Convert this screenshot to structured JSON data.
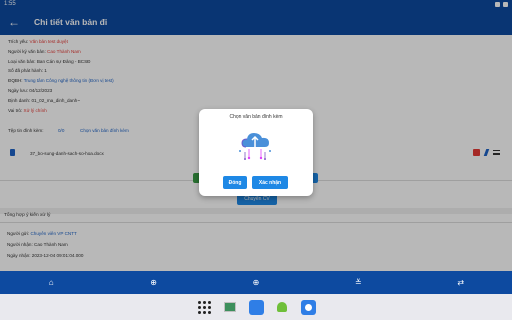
{
  "status_bar": {
    "time": "1:55"
  },
  "app_bar": {
    "title": "Chi tiết văn bản đi"
  },
  "info": {
    "trich_yeu_label": "Trích yếu:",
    "trich_yeu_value": "Văn bản test duyệt",
    "nguoi_ky_label": "Người ký văn bản:",
    "nguoi_ky_value": "Cao Thành Nam",
    "loai_vb": "Loại văn bản: Ban Cán sự Đảng - BCSĐ",
    "so_phat_hanh": "Số đã phát hành: 1",
    "dqbh_label": "ĐQBH:",
    "dqbh_value": "Trung tâm Công nghệ thông tin (Đơn vị test)",
    "ngay_luu": "Ngày lưu: 04/12/2023",
    "dinh_danh": "Định danh: 01_02_ma_dinh_danh~",
    "vai_tro_label": "Vai trò:",
    "vai_tro_value": "Xử lý chính"
  },
  "attachments": {
    "label": "Tệp tin đính kèm:",
    "badge": "0/0",
    "link": "Chọn văn bản đính kèm"
  },
  "file": {
    "name": "37_bo-sung-danh-sach-so-hoa.docx"
  },
  "buttons": {
    "chuyen_cv": "Chuyển CV"
  },
  "summary": {
    "title": "Tổng hợp ý kiến xử lý",
    "nguoi_gui_label": "Người gửi:",
    "nguoi_gui_value": "Chuyên viên VP CNTT",
    "nguoi_nhan": "Người nhận: Cao Thành Nam",
    "ngay_nhan": "Ngày nhận: 2023-12-04 09:01:04.000"
  },
  "dialog": {
    "title": "Chọn văn bản đính kèm",
    "close_label": "Đóng",
    "ok_label": "Xác nhận",
    "illustration": "cloud-upload-icon"
  },
  "bottom_nav": {
    "items": [
      "home-icon",
      "add-circle-icon",
      "add-circle-icon",
      "tune-icon",
      "swap-icon"
    ]
  },
  "taskbar": {
    "items": [
      "app-grid-icon",
      "gallery-icon",
      "photos-icon",
      "android-icon",
      "camera-icon"
    ]
  },
  "colors": {
    "primary": "#0d4aa0",
    "accent_blue": "#1e88e5",
    "link_blue": "#1e63c6",
    "red": "#e53935",
    "green": "#3a9b44"
  }
}
